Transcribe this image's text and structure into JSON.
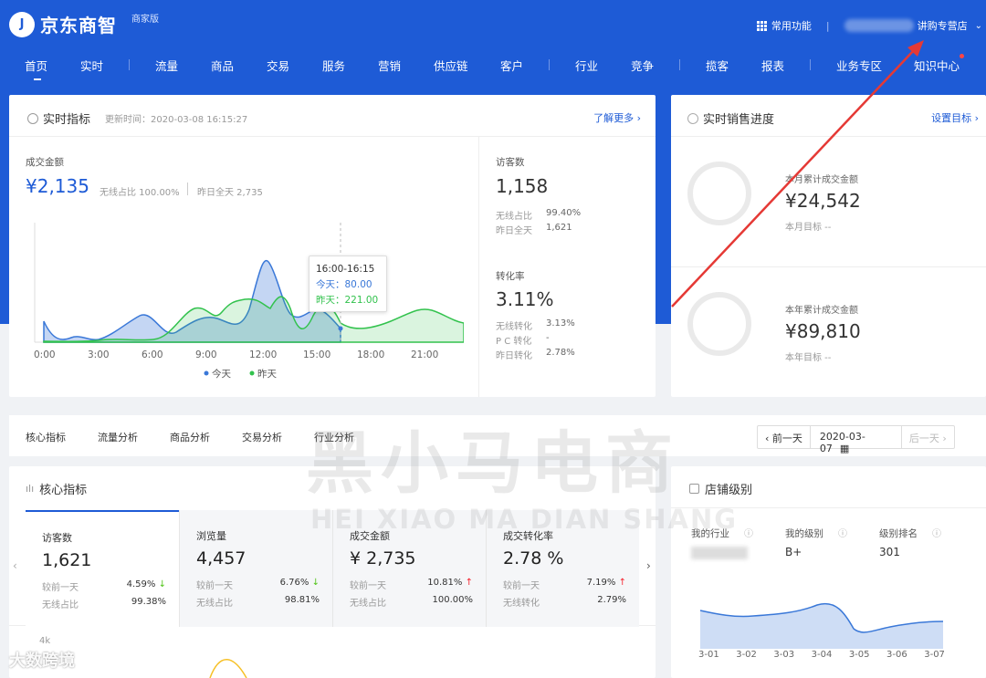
{
  "header": {
    "logo_mark": "J",
    "brand": "京东商智",
    "edition": "商家版",
    "common_functions": "常用功能",
    "store_name": "讲购专营店"
  },
  "nav": {
    "items": [
      "首页",
      "实时",
      "流量",
      "商品",
      "交易",
      "服务",
      "营销",
      "供应链",
      "客户",
      "行业",
      "竞争",
      "揽客",
      "报表",
      "业务专区",
      "知识中心"
    ]
  },
  "realtime": {
    "title": "实时指标",
    "update_time": "更新时间：2020-03-08 16:15:27",
    "learn_more": "了解更多",
    "gmv_label": "成交金额",
    "gmv_value": "¥2,135",
    "wireless_share": "无线占比 100.00%",
    "yesterday_total": "昨日全天 2,735",
    "visitors_label": "访客数",
    "visitors_value": "1,158",
    "visitors_wireless_label": "无线占比",
    "visitors_wireless_value": "99.40%",
    "visitors_yesterday_label": "昨日全天",
    "visitors_yesterday_value": "1,621",
    "conv_label": "转化率",
    "conv_value": "3.11%",
    "conv_wireless_label": "无线转化",
    "conv_wireless_value": "3.13%",
    "conv_pc_label": "P C 转化",
    "conv_pc_value": "-",
    "conv_yesterday_label": "昨日转化",
    "conv_yesterday_value": "2.78%",
    "tooltip_time": "16:00-16:15",
    "tooltip_today": "今天：80.00",
    "tooltip_yesterday": "昨天：221.00"
  },
  "chart_data": {
    "type": "area",
    "x": [
      "0:00",
      "3:00",
      "6:00",
      "9:00",
      "12:00",
      "15:00",
      "18:00",
      "21:00"
    ],
    "series": [
      {
        "name": "今天",
        "color": "#3a78d8"
      },
      {
        "name": "昨天",
        "color": "#32c24d"
      }
    ],
    "grid": false,
    "legend": "bottom"
  },
  "sales_progress": {
    "title": "实时销售进度",
    "set_target": "设置目标",
    "month_label": "本月累计成交金额",
    "month_value": "¥24,542",
    "month_target": "本月目标 --",
    "year_label": "本年累计成交金额",
    "year_value": "¥89,810",
    "year_target": "本年目标 --"
  },
  "tabs": {
    "items": [
      "核心指标",
      "流量分析",
      "商品分析",
      "交易分析",
      "行业分析"
    ],
    "prev_day": "前一天",
    "date": "2020-03-07",
    "next_day": "后一天"
  },
  "core": {
    "title": "核心指标",
    "compare_label": "较前一天",
    "metrics": [
      {
        "label": "访客数",
        "value": "1,621",
        "change": "4.59%",
        "dir": "down",
        "sub_label": "无线占比",
        "sub_value": "99.38%"
      },
      {
        "label": "浏览量",
        "value": "4,457",
        "change": "6.76%",
        "dir": "down",
        "sub_label": "无线占比",
        "sub_value": "98.81%"
      },
      {
        "label": "成交金额",
        "value": "¥ 2,735",
        "change": "10.81%",
        "dir": "up",
        "sub_label": "无线占比",
        "sub_value": "100.00%"
      },
      {
        "label": "成交转化率",
        "value": "2.78 %",
        "change": "7.19%",
        "dir": "up",
        "sub_label": "无线转化",
        "sub_value": "2.79%"
      }
    ],
    "y_tick": "4k"
  },
  "level": {
    "title": "店铺级别",
    "industry_label": "我的行业",
    "level_label": "我的级别",
    "level_value": "B+",
    "rank_label": "级别排名",
    "rank_value": "301",
    "dates": [
      "3-01",
      "3-02",
      "3-03",
      "3-04",
      "3-05",
      "3-06",
      "3-07"
    ]
  },
  "watermark": {
    "cn": "黑小马电商",
    "en": "HEI XIAO MA DIAN SHANG",
    "corner": "大数跨境"
  }
}
